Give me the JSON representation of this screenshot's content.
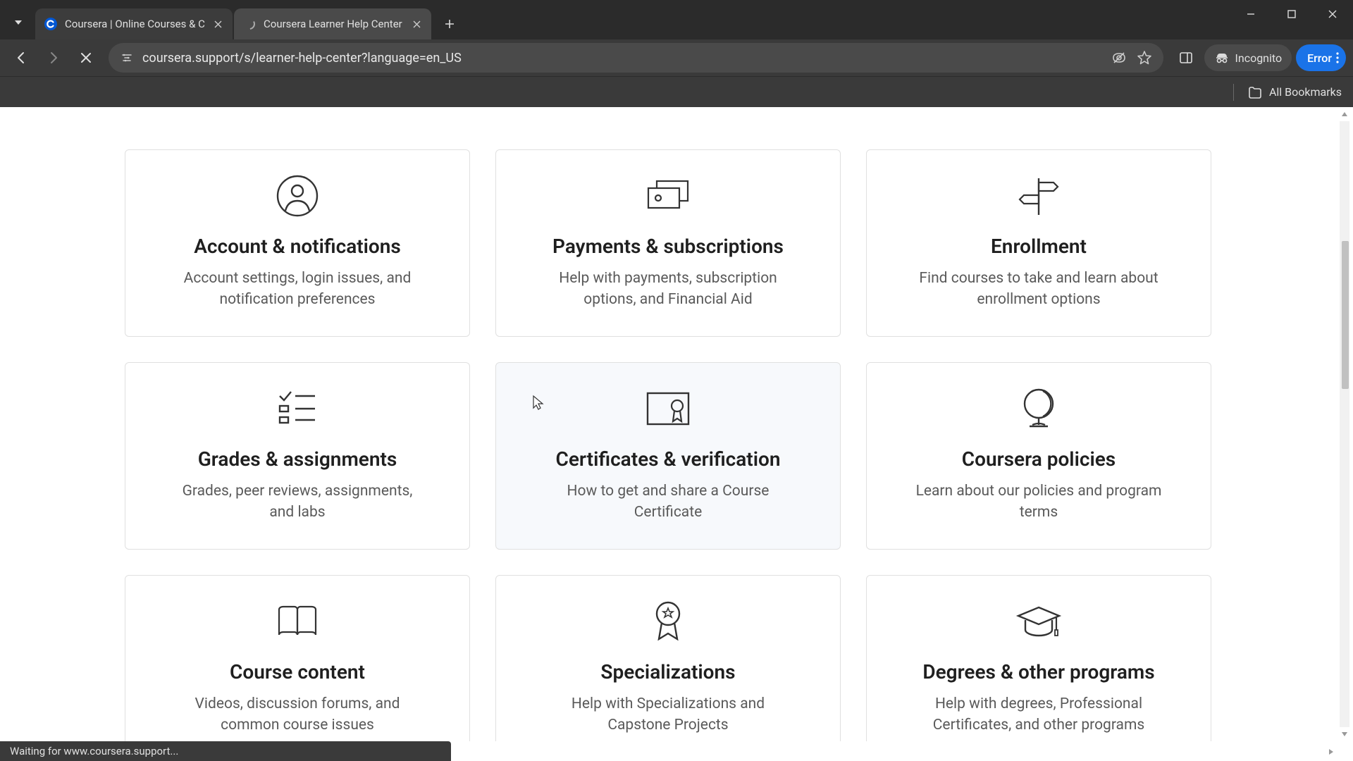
{
  "browser": {
    "tabs": [
      {
        "title": "Coursera | Online Courses & C",
        "active": false
      },
      {
        "title": "Coursera Learner Help Center",
        "active": true
      }
    ],
    "address": "coursera.support/s/learner-help-center?language=en_US",
    "incognito_label": "Incognito",
    "error_label": "Error",
    "all_bookmarks_label": "All Bookmarks"
  },
  "cards": [
    {
      "id": "account",
      "title": "Account & notifications",
      "desc": "Account settings, login issues, and notification preferences",
      "icon": "user-circle-icon"
    },
    {
      "id": "payments",
      "title": "Payments & subscriptions",
      "desc": "Help with payments, subscription options, and Financial Aid",
      "icon": "money-icon"
    },
    {
      "id": "enrollment",
      "title": "Enrollment",
      "desc": "Find courses to take and learn about enrollment options",
      "icon": "signpost-icon"
    },
    {
      "id": "grades",
      "title": "Grades & assignments",
      "desc": "Grades, peer reviews, assignments, and labs",
      "icon": "checklist-icon"
    },
    {
      "id": "certificates",
      "title": "Certificates & verification",
      "desc": "How to get and share a Course Certificate",
      "icon": "certificate-icon"
    },
    {
      "id": "policies",
      "title": "Coursera policies",
      "desc": "Learn about our policies and program terms",
      "icon": "globe-icon"
    },
    {
      "id": "content",
      "title": "Course content",
      "desc": "Videos, discussion forums, and common course issues",
      "icon": "book-icon"
    },
    {
      "id": "specializations",
      "title": "Specializations",
      "desc": "Help with Specializations and Capstone Projects",
      "icon": "ribbon-icon"
    },
    {
      "id": "degrees",
      "title": "Degrees & other programs",
      "desc": "Help with degrees, Professional Certificates, and other programs",
      "icon": "grad-cap-icon"
    }
  ],
  "status_text": "Waiting for www.coursera.support..."
}
